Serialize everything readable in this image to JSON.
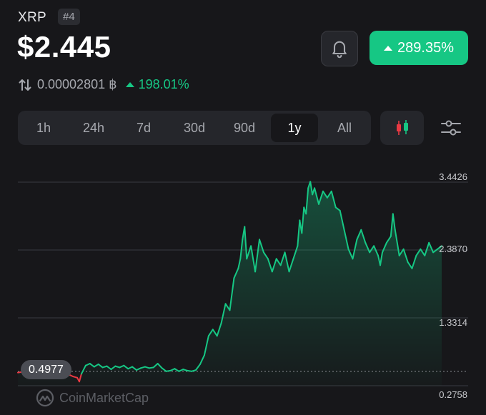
{
  "coin": {
    "symbol": "XRP",
    "rank": "#4",
    "price": "$2.445"
  },
  "change": {
    "percent": "289.35%"
  },
  "btc": {
    "icon": "swap-vertical-icon",
    "value": "0.00002801 ฿",
    "change": "198.01%"
  },
  "colors": {
    "up": "#16c784",
    "down": "#ea3943",
    "bg": "#17171a",
    "panel": "#25262b"
  },
  "tabs": [
    {
      "label": "1h"
    },
    {
      "label": "24h"
    },
    {
      "label": "7d"
    },
    {
      "label": "30d"
    },
    {
      "label": "90d"
    },
    {
      "label": "1y",
      "active": true
    },
    {
      "label": "All"
    }
  ],
  "icons": {
    "alert": "bell-icon",
    "candles": "candlestick-icon",
    "settings": "sliders-icon"
  },
  "watermark": {
    "text": "CoinMarketCap"
  },
  "chart_data": {
    "type": "area",
    "yticks": [
      "3.4426",
      "2.3870",
      "1.3314",
      "0.2758"
    ],
    "y_values": [
      3.4426,
      2.387,
      1.3314,
      0.2758
    ],
    "start_price": 0.4977,
    "start_label": "0.4977",
    "grid": true,
    "points": [
      [
        0,
        0.48
      ],
      [
        0.01,
        0.49
      ],
      [
        0.02,
        0.52
      ],
      [
        0.03,
        0.5
      ],
      [
        0.04,
        0.51
      ],
      [
        0.05,
        0.47
      ],
      [
        0.06,
        0.49
      ],
      [
        0.07,
        0.46
      ],
      [
        0.08,
        0.47
      ],
      [
        0.09,
        0.44
      ],
      [
        0.1,
        0.46
      ],
      [
        0.11,
        0.43
      ],
      [
        0.12,
        0.45
      ],
      [
        0.13,
        0.42
      ],
      [
        0.14,
        0.4
      ],
      [
        0.145,
        0.34
      ],
      [
        0.15,
        0.46
      ],
      [
        0.16,
        0.59
      ],
      [
        0.17,
        0.62
      ],
      [
        0.18,
        0.57
      ],
      [
        0.19,
        0.61
      ],
      [
        0.2,
        0.56
      ],
      [
        0.21,
        0.58
      ],
      [
        0.22,
        0.53
      ],
      [
        0.23,
        0.58
      ],
      [
        0.24,
        0.56
      ],
      [
        0.25,
        0.59
      ],
      [
        0.26,
        0.54
      ],
      [
        0.27,
        0.57
      ],
      [
        0.28,
        0.52
      ],
      [
        0.29,
        0.55
      ],
      [
        0.3,
        0.57
      ],
      [
        0.31,
        0.55
      ],
      [
        0.32,
        0.56
      ],
      [
        0.33,
        0.62
      ],
      [
        0.34,
        0.55
      ],
      [
        0.35,
        0.5
      ],
      [
        0.36,
        0.51
      ],
      [
        0.37,
        0.54
      ],
      [
        0.38,
        0.5
      ],
      [
        0.39,
        0.53
      ],
      [
        0.4,
        0.51
      ],
      [
        0.41,
        0.5
      ],
      [
        0.42,
        0.52
      ],
      [
        0.43,
        0.61
      ],
      [
        0.44,
        0.75
      ],
      [
        0.45,
        1.05
      ],
      [
        0.46,
        1.15
      ],
      [
        0.47,
        1.05
      ],
      [
        0.48,
        1.25
      ],
      [
        0.49,
        1.55
      ],
      [
        0.5,
        1.45
      ],
      [
        0.51,
        1.95
      ],
      [
        0.52,
        2.1
      ],
      [
        0.525,
        2.25
      ],
      [
        0.53,
        2.55
      ],
      [
        0.535,
        2.75
      ],
      [
        0.54,
        2.25
      ],
      [
        0.55,
        2.45
      ],
      [
        0.56,
        2.05
      ],
      [
        0.57,
        2.55
      ],
      [
        0.58,
        2.35
      ],
      [
        0.59,
        2.25
      ],
      [
        0.6,
        2.05
      ],
      [
        0.61,
        2.25
      ],
      [
        0.62,
        2.15
      ],
      [
        0.63,
        2.35
      ],
      [
        0.64,
        2.05
      ],
      [
        0.65,
        2.25
      ],
      [
        0.66,
        2.45
      ],
      [
        0.665,
        2.85
      ],
      [
        0.67,
        2.65
      ],
      [
        0.675,
        3.05
      ],
      [
        0.68,
        2.95
      ],
      [
        0.685,
        3.35
      ],
      [
        0.69,
        3.45
      ],
      [
        0.695,
        3.25
      ],
      [
        0.7,
        3.35
      ],
      [
        0.71,
        3.1
      ],
      [
        0.72,
        3.3
      ],
      [
        0.73,
        3.2
      ],
      [
        0.74,
        3.3
      ],
      [
        0.75,
        3.05
      ],
      [
        0.76,
        3.0
      ],
      [
        0.77,
        2.7
      ],
      [
        0.78,
        2.4
      ],
      [
        0.79,
        2.25
      ],
      [
        0.8,
        2.55
      ],
      [
        0.81,
        2.7
      ],
      [
        0.82,
        2.5
      ],
      [
        0.83,
        2.35
      ],
      [
        0.84,
        2.45
      ],
      [
        0.85,
        2.3
      ],
      [
        0.855,
        2.15
      ],
      [
        0.86,
        2.35
      ],
      [
        0.87,
        2.5
      ],
      [
        0.88,
        2.6
      ],
      [
        0.885,
        2.95
      ],
      [
        0.89,
        2.7
      ],
      [
        0.9,
        2.3
      ],
      [
        0.91,
        2.4
      ],
      [
        0.92,
        2.2
      ],
      [
        0.93,
        2.1
      ],
      [
        0.94,
        2.3
      ],
      [
        0.95,
        2.4
      ],
      [
        0.96,
        2.3
      ],
      [
        0.97,
        2.5
      ],
      [
        0.98,
        2.35
      ],
      [
        1.0,
        2.45
      ]
    ]
  }
}
